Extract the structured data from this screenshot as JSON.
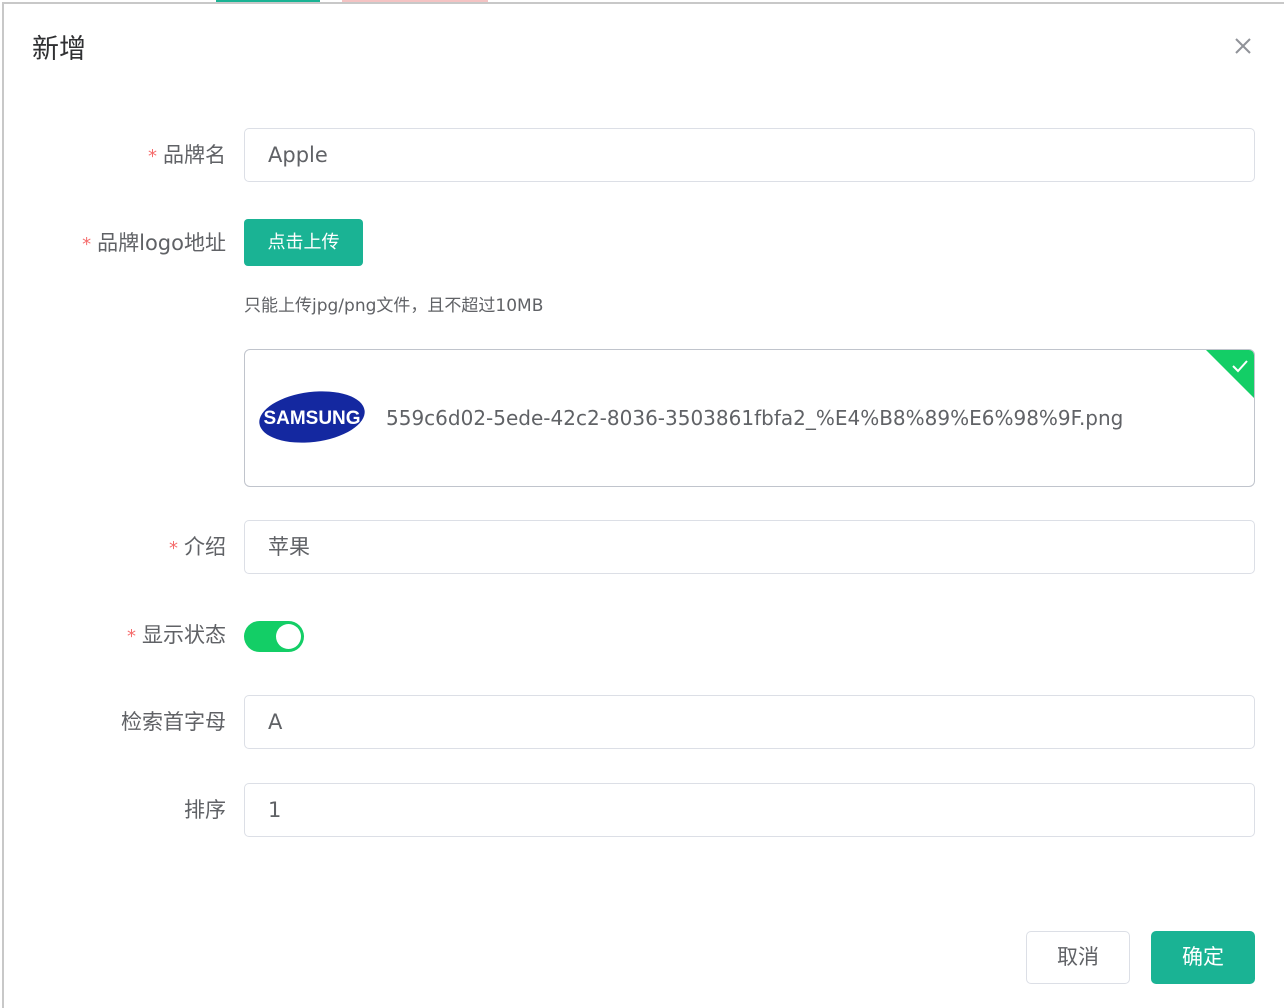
{
  "dialog": {
    "title": "新增",
    "close_icon": "close-icon"
  },
  "form": {
    "brand_name": {
      "label": "品牌名",
      "required": "*",
      "value": "Apple"
    },
    "logo": {
      "label": "品牌logo地址",
      "required": "*",
      "upload_button": "点击上传",
      "tip": "只能上传jpg/png文件，且不超过10MB",
      "file": {
        "name": "559c6d02-5ede-42c2-8036-3503861fbfa2_%E4%B8%89%E6%98%9F.png",
        "thumbnail_text": "SAMSUNG",
        "status_icon": "check-icon"
      }
    },
    "description": {
      "label": "介绍",
      "required": "*",
      "value": "苹果"
    },
    "show_status": {
      "label": "显示状态",
      "required": "*",
      "enabled": true
    },
    "first_letter": {
      "label": "检索首字母",
      "value": "A"
    },
    "sort": {
      "label": "排序",
      "value": "1"
    }
  },
  "footer": {
    "cancel_label": "取消",
    "confirm_label": "确定"
  },
  "colors": {
    "primary": "#1ab394",
    "switch_on": "#13ce66",
    "required": "#f56c6c",
    "samsung_blue": "#1428a0"
  }
}
